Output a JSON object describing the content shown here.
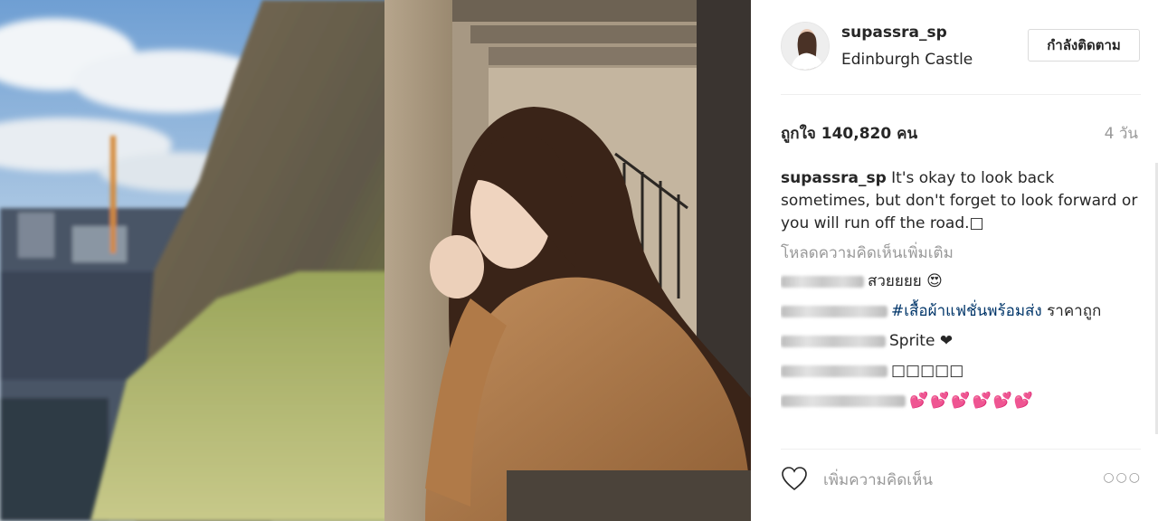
{
  "post": {
    "username": "supassra_sp",
    "location": "Edinburgh Castle",
    "follow_button_label": "กำลังติดตาม",
    "likes_text": "ถูกใจ 140,820 คน",
    "time_text": "4 วัน",
    "caption": {
      "author": "supassra_sp",
      "text": "It's okay to look back sometimes, but don't forget to look forward or you will run off the road.□"
    },
    "load_more_label": "โหลดความคิดเห็นเพิ่มเติม",
    "comments": [
      {
        "text": "สวยยยย 😍"
      },
      {
        "hashtag": "#เสื้อผ้าแฟชั่นพร้อมส่ง",
        "text": " ราคาถูก"
      },
      {
        "text": "Sprite ❤"
      },
      {
        "text": "□□□□□"
      },
      {
        "text": "💕💕💕💕💕💕"
      }
    ],
    "add_comment_placeholder": "เพิ่มความคิดเห็น",
    "more_label": "○○○"
  },
  "icons": {
    "like": "heart-outline-icon",
    "more": "more-options-icon"
  }
}
